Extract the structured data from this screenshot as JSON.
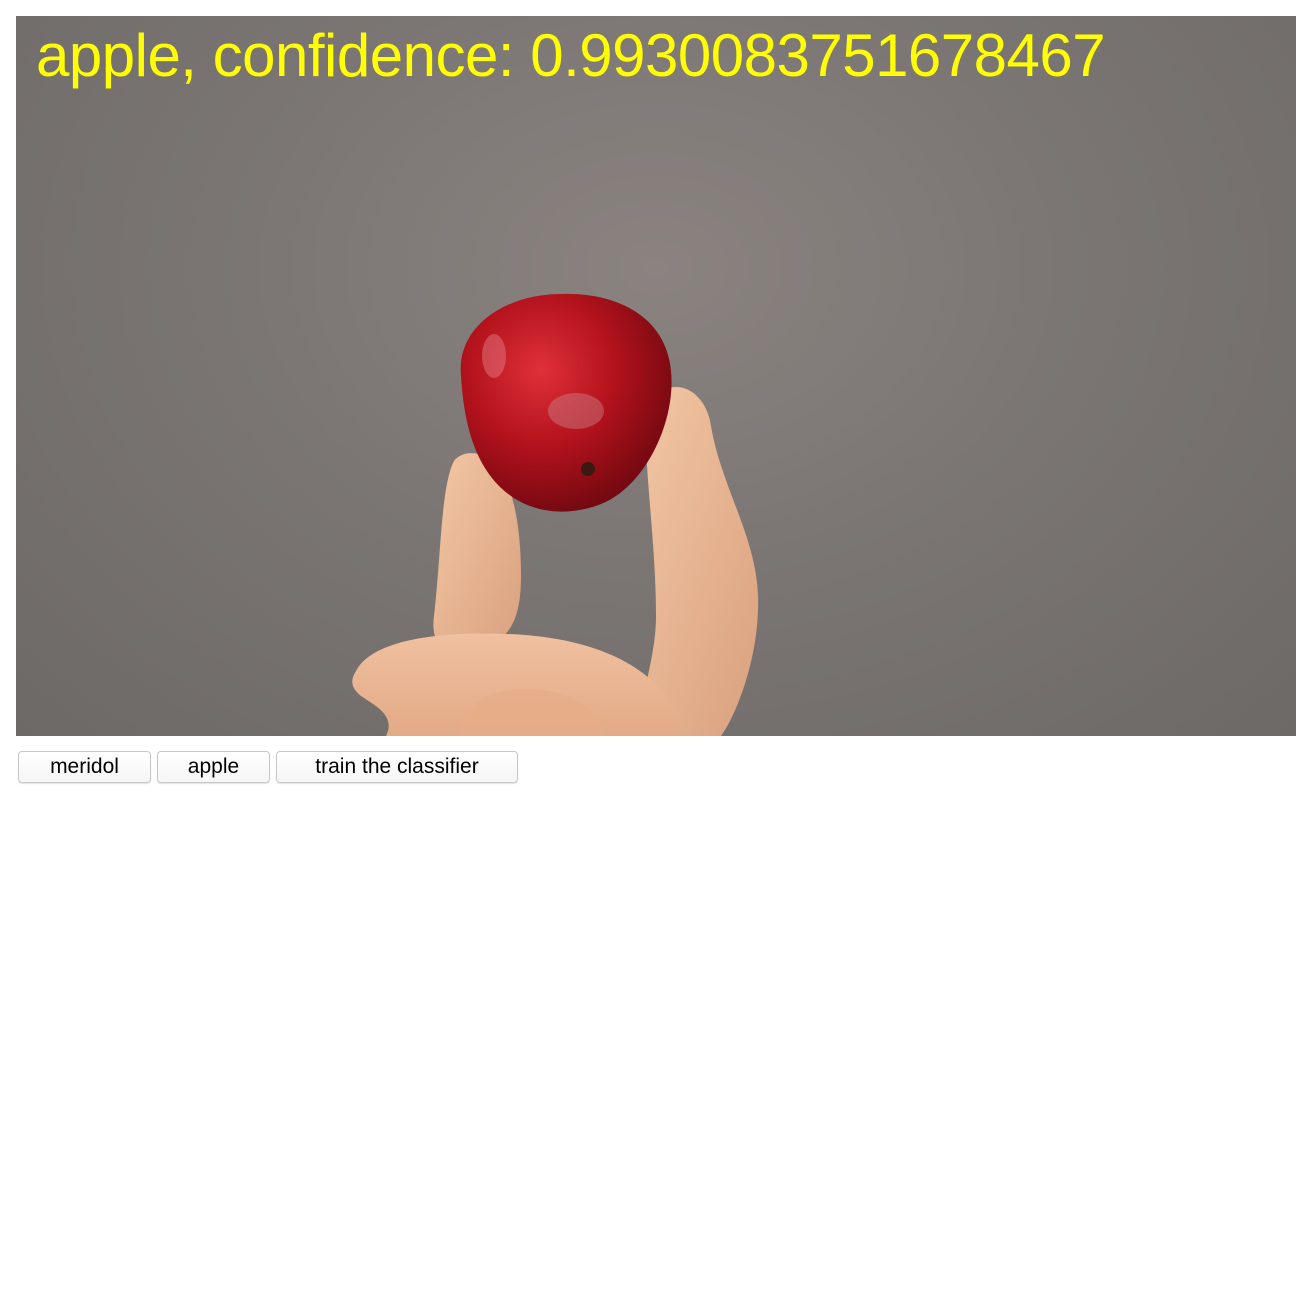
{
  "prediction": {
    "label": "apple",
    "confidence": "0.9930083751678467",
    "text": "apple, confidence: 0.9930083751678467",
    "text_color": "#ffff00"
  },
  "camera_feed": {
    "subject": "hand holding a red apple",
    "background_color": "#7b7674"
  },
  "buttons": {
    "meridol_label": "meridol",
    "apple_label": "apple",
    "train_label": "train the classifier"
  }
}
